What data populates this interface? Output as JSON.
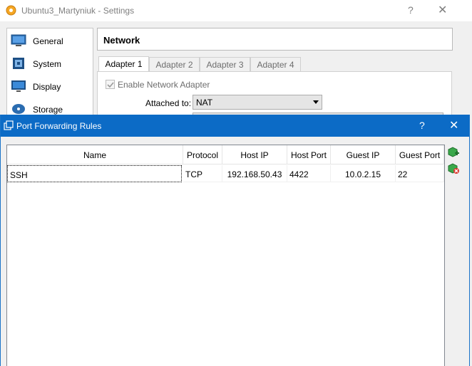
{
  "settings_window": {
    "title": "Ubuntu3_Martyniuk  - Settings",
    "help_label": "?",
    "close_label": "✕",
    "sidebar": {
      "items": [
        {
          "label": "General",
          "icon": "general-icon"
        },
        {
          "label": "System",
          "icon": "system-icon"
        },
        {
          "label": "Display",
          "icon": "display-icon"
        },
        {
          "label": "Storage",
          "icon": "storage-icon"
        }
      ]
    },
    "section_title": "Network",
    "tabs": [
      {
        "label": "Adapter 1",
        "active": true
      },
      {
        "label": "Adapter 2",
        "active": false
      },
      {
        "label": "Adapter 3",
        "active": false
      },
      {
        "label": "Adapter 4",
        "active": false
      }
    ],
    "enable_adapter_label": "Enable Network Adapter",
    "enable_adapter_checked": true,
    "attached_to_label": "Attached to:",
    "attached_to_value": "NAT"
  },
  "port_forwarding": {
    "title": "Port Forwarding Rules",
    "help_label": "?",
    "close_label": "✕",
    "columns": [
      "Name",
      "Protocol",
      "Host IP",
      "Host Port",
      "Guest IP",
      "Guest Port"
    ],
    "rows": [
      {
        "name": "SSH",
        "protocol": "TCP",
        "host_ip": "192.168.50.43",
        "host_port": "4422",
        "guest_ip": "10.0.2.15",
        "guest_port": "22"
      }
    ],
    "actions": {
      "add_icon": "add-rule-icon",
      "remove_icon": "remove-rule-icon"
    }
  },
  "colors": {
    "dialog_titlebar": "#0c6bc6",
    "window_background": "#f0f0f0"
  }
}
